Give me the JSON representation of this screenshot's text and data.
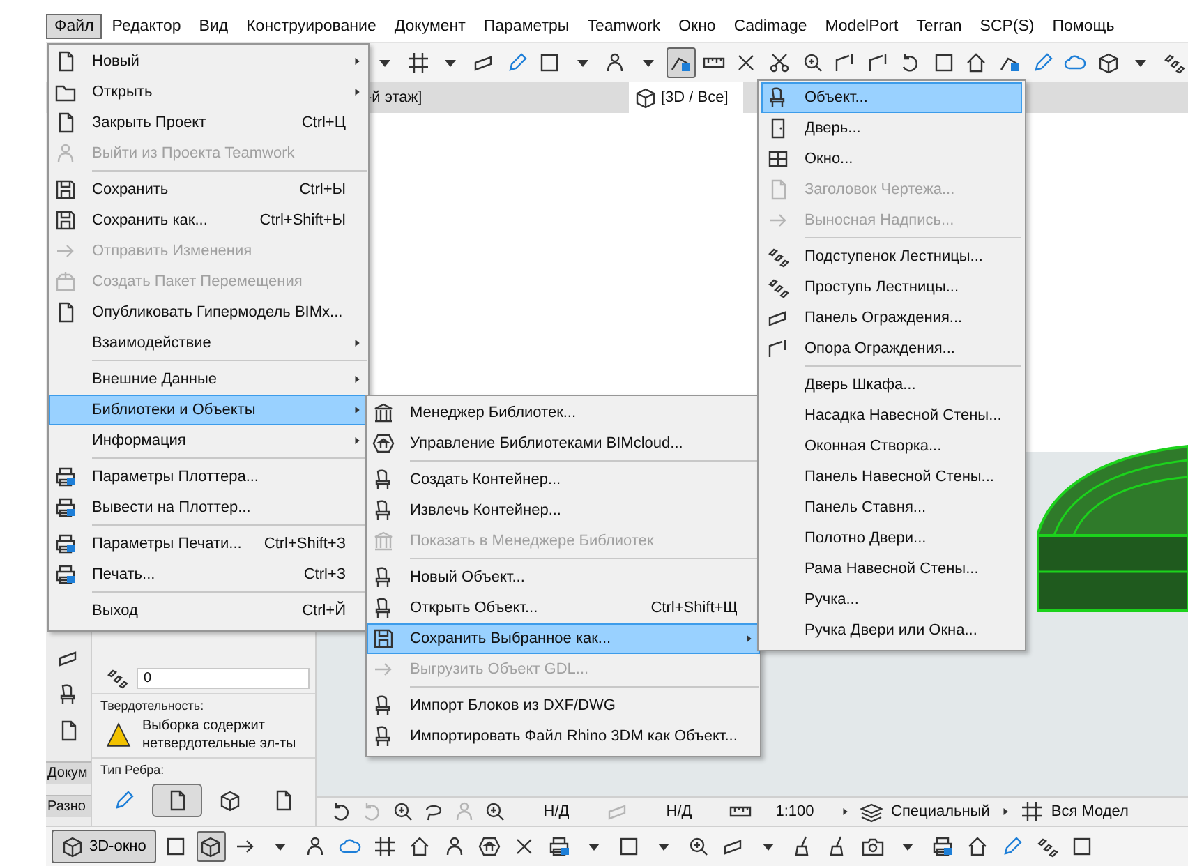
{
  "menubar": [
    {
      "label": "Файл",
      "selected": true
    },
    {
      "label": "Редактор",
      "selected": false
    },
    {
      "label": "Вид",
      "selected": false
    },
    {
      "label": "Конструирование",
      "selected": false
    },
    {
      "label": "Документ",
      "selected": false
    },
    {
      "label": "Параметры",
      "selected": false
    },
    {
      "label": "Teamwork",
      "selected": false
    },
    {
      "label": "Окно",
      "selected": false
    },
    {
      "label": "Cadimage",
      "selected": false
    },
    {
      "label": "ModelPort",
      "selected": false
    },
    {
      "label": "Terran",
      "selected": false
    },
    {
      "label": "SCP(S)",
      "selected": false
    },
    {
      "label": "Помощь",
      "selected": false
    }
  ],
  "toolbar": {
    "buttons": [
      {
        "selected": false
      },
      {
        "selected": false
      },
      {
        "selected": false
      },
      {
        "selected": false
      },
      {
        "selected": false
      },
      {
        "selected": false
      },
      {
        "selected": false
      },
      {
        "selected": false
      },
      {
        "selected": false
      },
      {
        "selected": true
      },
      {
        "selected": false
      },
      {
        "selected": false
      },
      {
        "selected": false
      },
      {
        "selected": false
      },
      {
        "selected": false
      },
      {
        "selected": false
      },
      {
        "selected": false
      },
      {
        "selected": false
      },
      {
        "selected": false
      },
      {
        "selected": false
      },
      {
        "selected": false
      },
      {
        "selected": false
      },
      {
        "selected": false
      },
      {
        "selected": false
      },
      {
        "selected": false
      }
    ]
  },
  "tabs": [
    {
      "label": "-й этаж]",
      "selected": false
    },
    {
      "label": "[3D / Все]",
      "selected": true
    }
  ],
  "left_tabs": [
    "Докум",
    "Разно"
  ],
  "properties": {
    "value": "0",
    "solidity_label": "Твердотельность:",
    "solidity_note": "Выборка содержит нетвердотельные эл-ты",
    "edge_label": "Тип Ребра:",
    "edge_buttons": [
      {
        "selected": false
      },
      {
        "selected": true
      },
      {
        "selected": false
      },
      {
        "selected": false
      }
    ]
  },
  "status_bar": {
    "fields": [
      "Н/Д",
      "Н/Д",
      "1:100",
      "Специальный",
      "Вся Модел"
    ]
  },
  "bottom_toolbar": {
    "view_button": {
      "label": "3D-окно",
      "selected": true
    },
    "buttons": [
      {
        "selected": false
      },
      {
        "selected": true
      },
      {
        "selected": false
      },
      {
        "selected": false
      },
      {
        "selected": false
      },
      {
        "selected": false
      },
      {
        "selected": false
      },
      {
        "selected": false
      },
      {
        "selected": false
      },
      {
        "selected": false
      },
      {
        "selected": false
      },
      {
        "selected": false
      },
      {
        "selected": false
      },
      {
        "selected": false
      },
      {
        "selected": false
      },
      {
        "selected": false
      },
      {
        "selected": false
      },
      {
        "selected": false
      },
      {
        "selected": false
      },
      {
        "selected": false
      },
      {
        "selected": false
      },
      {
        "selected": false
      },
      {
        "selected": false
      },
      {
        "selected": false
      },
      {
        "selected": false
      },
      {
        "selected": false
      },
      {
        "selected": false
      }
    ]
  },
  "file_menu": {
    "items": [
      {
        "label": "Новый",
        "disabled": false,
        "selected": false,
        "submenu": true,
        "separator_after": false
      },
      {
        "label": "Открыть",
        "disabled": false,
        "selected": false,
        "submenu": true,
        "separator_after": false
      },
      {
        "label": "Закрыть Проект",
        "shortcut": "Ctrl+Ц",
        "disabled": false,
        "selected": false,
        "submenu": false,
        "separator_after": false
      },
      {
        "label": "Выйти из Проекта Teamwork",
        "disabled": true,
        "selected": false,
        "submenu": false,
        "separator_after": true
      },
      {
        "label": "Сохранить",
        "shortcut": "Ctrl+Ы",
        "disabled": false,
        "selected": false,
        "submenu": false,
        "separator_after": false
      },
      {
        "label": "Сохранить как...",
        "shortcut": "Ctrl+Shift+Ы",
        "disabled": false,
        "selected": false,
        "submenu": false,
        "separator_after": false
      },
      {
        "label": "Отправить Изменения",
        "disabled": true,
        "selected": false,
        "submenu": false,
        "separator_after": false
      },
      {
        "label": "Создать Пакет Перемещения",
        "disabled": true,
        "selected": false,
        "submenu": false,
        "separator_after": false
      },
      {
        "label": "Опубликовать Гипермодель BIMx...",
        "disabled": false,
        "selected": false,
        "submenu": false,
        "separator_after": false
      },
      {
        "label": "Взаимодействие",
        "disabled": false,
        "selected": false,
        "submenu": true,
        "separator_after": true
      },
      {
        "label": "Внешние Данные",
        "disabled": false,
        "selected": false,
        "submenu": true,
        "separator_after": false
      },
      {
        "label": "Библиотеки и Объекты",
        "disabled": false,
        "selected": true,
        "submenu": true,
        "separator_after": false
      },
      {
        "label": "Информация",
        "disabled": false,
        "selected": false,
        "submenu": true,
        "separator_after": true
      },
      {
        "label": "Параметры Плоттера...",
        "disabled": false,
        "selected": false,
        "submenu": false,
        "separator_after": false
      },
      {
        "label": "Вывести на Плоттер...",
        "disabled": false,
        "selected": false,
        "submenu": false,
        "separator_after": true
      },
      {
        "label": "Параметры Печати...",
        "shortcut": "Ctrl+Shift+З",
        "disabled": false,
        "selected": false,
        "submenu": false,
        "separator_after": false
      },
      {
        "label": "Печать...",
        "shortcut": "Ctrl+З",
        "disabled": false,
        "selected": false,
        "submenu": false,
        "separator_after": true
      },
      {
        "label": "Выход",
        "shortcut": "Ctrl+Й",
        "disabled": false,
        "selected": false,
        "submenu": false,
        "separator_after": false
      }
    ]
  },
  "libraries_menu": {
    "items": [
      {
        "label": "Менеджер Библиотек...",
        "disabled": false,
        "selected": false,
        "submenu": false,
        "separator_after": false
      },
      {
        "label": "Управление Библиотеками BIMcloud...",
        "disabled": false,
        "selected": false,
        "submenu": false,
        "separator_after": true
      },
      {
        "label": "Создать Контейнер...",
        "disabled": false,
        "selected": false,
        "submenu": false,
        "separator_after": false
      },
      {
        "label": "Извлечь Контейнер...",
        "disabled": false,
        "selected": false,
        "submenu": false,
        "separator_after": false
      },
      {
        "label": "Показать в Менеджере Библиотек",
        "disabled": true,
        "selected": false,
        "submenu": false,
        "separator_after": true
      },
      {
        "label": "Новый Объект...",
        "disabled": false,
        "selected": false,
        "submenu": false,
        "separator_after": false
      },
      {
        "label": "Открыть Объект...",
        "shortcut": "Ctrl+Shift+Щ",
        "disabled": false,
        "selected": false,
        "submenu": false,
        "separator_after": false
      },
      {
        "label": "Сохранить Выбранное как...",
        "disabled": false,
        "selected": true,
        "submenu": true,
        "separator_after": false
      },
      {
        "label": "Выгрузить Объект GDL...",
        "disabled": true,
        "selected": false,
        "submenu": false,
        "separator_after": true
      },
      {
        "label": "Импорт Блоков из DXF/DWG",
        "disabled": false,
        "selected": false,
        "submenu": false,
        "separator_after": false
      },
      {
        "label": "Импортировать Файл Rhino 3DM как Объект...",
        "disabled": false,
        "selected": false,
        "submenu": false,
        "separator_after": false
      }
    ]
  },
  "object_menu": {
    "items": [
      {
        "label": "Объект...",
        "disabled": false,
        "selected": true,
        "submenu": false,
        "separator_after": false
      },
      {
        "label": "Дверь...",
        "disabled": false,
        "selected": false,
        "submenu": false,
        "separator_after": false
      },
      {
        "label": "Окно...",
        "disabled": false,
        "selected": false,
        "submenu": false,
        "separator_after": false
      },
      {
        "label": "Заголовок Чертежа...",
        "disabled": true,
        "selected": false,
        "submenu": false,
        "separator_after": false
      },
      {
        "label": "Выносная Надпись...",
        "disabled": true,
        "selected": false,
        "submenu": false,
        "separator_after": true
      },
      {
        "label": "Подступенок Лестницы...",
        "disabled": false,
        "selected": false,
        "submenu": false,
        "separator_after": false
      },
      {
        "label": "Проступь Лестницы...",
        "disabled": false,
        "selected": false,
        "submenu": false,
        "separator_after": false
      },
      {
        "label": "Панель Ограждения...",
        "disabled": false,
        "selected": false,
        "submenu": false,
        "separator_after": false
      },
      {
        "label": "Опора Ограждения...",
        "disabled": false,
        "selected": false,
        "submenu": false,
        "separator_after": true
      },
      {
        "label": "Дверь Шкафа...",
        "disabled": false,
        "selected": false,
        "submenu": false,
        "separator_after": false
      },
      {
        "label": "Насадка Навесной Стены...",
        "disabled": false,
        "selected": false,
        "submenu": false,
        "separator_after": false
      },
      {
        "label": "Оконная Створка...",
        "disabled": false,
        "selected": false,
        "submenu": false,
        "separator_after": false
      },
      {
        "label": "Панель Навесной Стены...",
        "disabled": false,
        "selected": false,
        "submenu": false,
        "separator_after": false
      },
      {
        "label": "Панель Ставня...",
        "disabled": false,
        "selected": false,
        "submenu": false,
        "separator_after": false
      },
      {
        "label": "Полотно Двери...",
        "disabled": false,
        "selected": false,
        "submenu": false,
        "separator_after": false
      },
      {
        "label": "Рама Навесной Стены...",
        "disabled": false,
        "selected": false,
        "submenu": false,
        "separator_after": false
      },
      {
        "label": "Ручка...",
        "disabled": false,
        "selected": false,
        "submenu": false,
        "separator_after": false
      },
      {
        "label": "Ручка Двери или Окна...",
        "disabled": false,
        "selected": false,
        "submenu": false,
        "separator_after": false
      }
    ]
  }
}
